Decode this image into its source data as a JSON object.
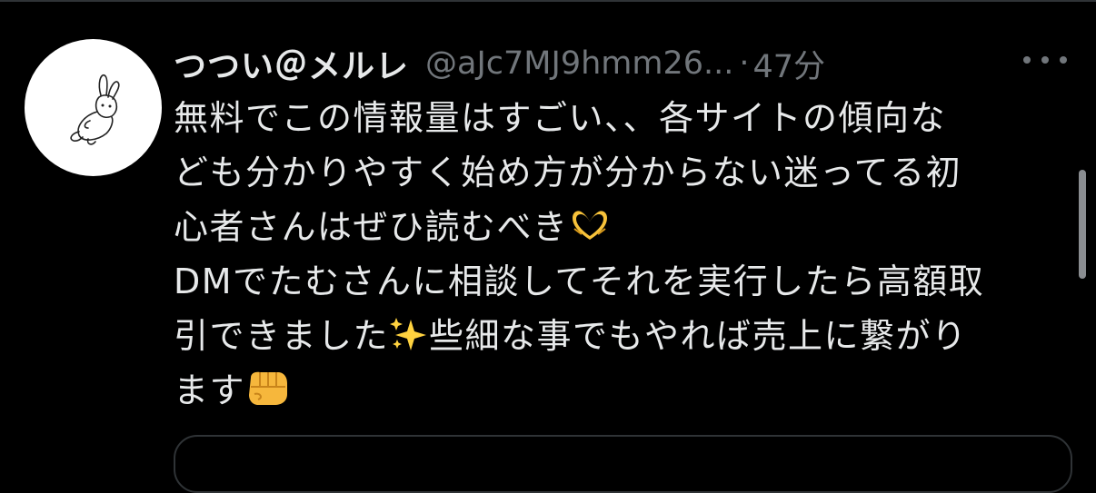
{
  "tweet": {
    "display_name": "つつい＠メルレ",
    "handle": "@aJc7MJ9hmm26...",
    "separator": "·",
    "time": "47分",
    "lines": [
      "無料でこの情報量はすごい、、各サイトの傾向な",
      "ども分かりやすく始め方が分からない迷ってる初",
      "心者さんはぜひ読むべき",
      "DMでたむさんに相談してそれを実行したら高額取",
      "引できました",
      "些細な事でもやれば売上に繋がり",
      "ます"
    ],
    "emojis": [
      "heart-hands",
      "sparkles",
      "oncoming-fist"
    ]
  },
  "icons": {
    "avatar": "rabbit-doodle-avatar",
    "more": "ellipsis-icon"
  },
  "colors": {
    "background": "#000000",
    "text_primary": "#e7e9ea",
    "text_secondary": "#71767b",
    "divider": "#2f3336"
  }
}
